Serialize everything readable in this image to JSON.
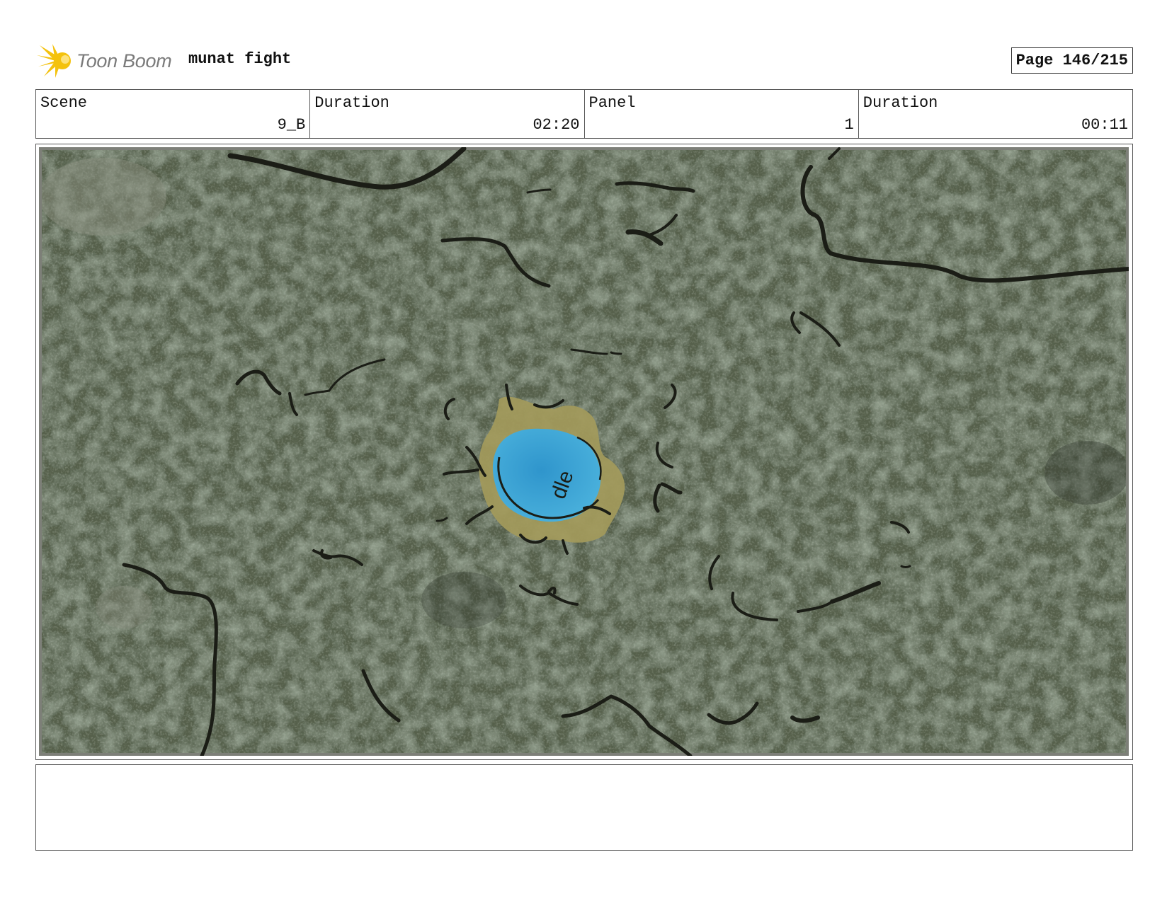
{
  "header": {
    "logo_text": "Toon Boom",
    "project_title": "munat fight",
    "page_label": "Page 146/215"
  },
  "info": {
    "scene_label": "Scene",
    "scene_value": "9_B",
    "scene_duration_label": "Duration",
    "scene_duration_value": "02:20",
    "panel_label": "Panel",
    "panel_value": "1",
    "panel_duration_label": "Duration",
    "panel_duration_value": "00:11"
  },
  "notes": {
    "text": ""
  },
  "colors": {
    "forest": "#59634f",
    "water": "#3ea6d6",
    "sand": "#a39a5b",
    "ink": "#1b1d16",
    "logo_yellow": "#f4c20d"
  }
}
